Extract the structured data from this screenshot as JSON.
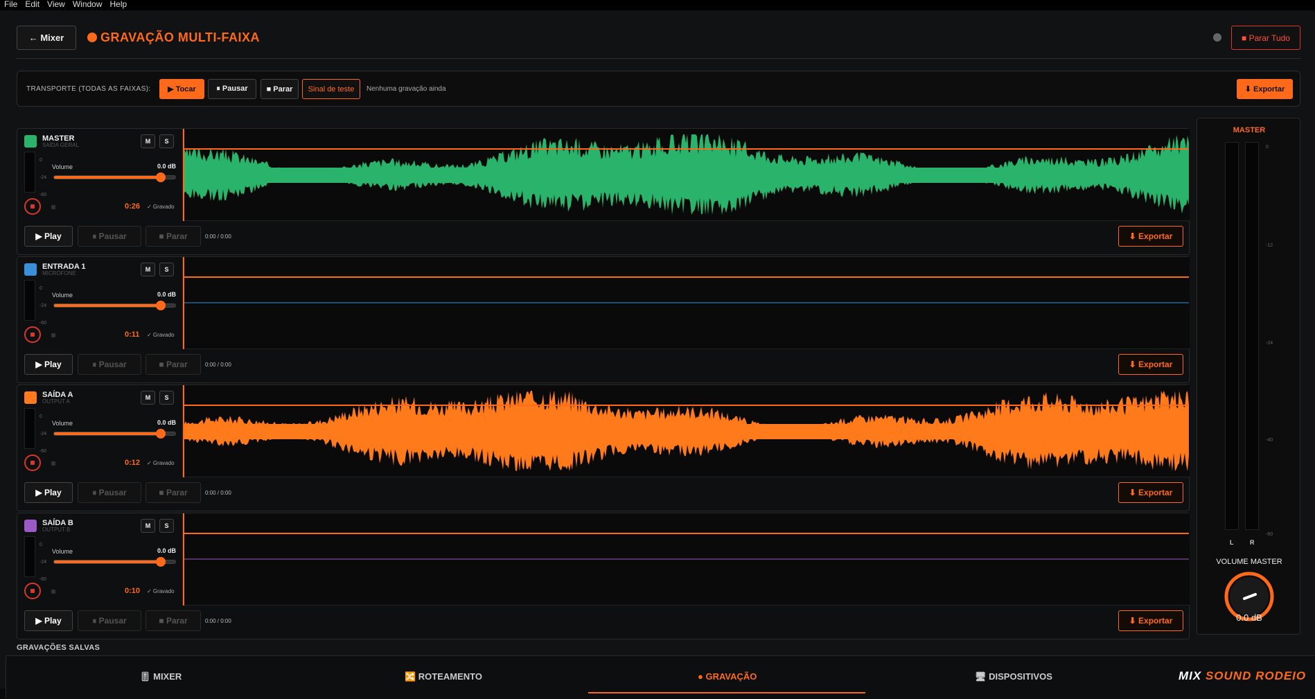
{
  "menu": [
    "File",
    "Edit",
    "View",
    "Window",
    "Help"
  ],
  "header": {
    "back_label": "← Mixer",
    "title": "GRAVAÇÃO MULTI-FAIXA",
    "stop_all": "■ Parar Tudo"
  },
  "transport": {
    "label": "TRANSPORTE (TODAS AS FAIXAS):",
    "play": "▶ Tocar",
    "pause": "⏸ Pausar",
    "stop": "■ Parar",
    "test_signal": "Sinal de teste",
    "status": "Nenhuma gravação ainda",
    "export": "⬇ Exportar"
  },
  "tracks": [
    {
      "name": "MASTER",
      "sub": "SAÍDA GERAL",
      "color": "#2ab36a",
      "volume_label": "Volume",
      "volume_db": "0.0 dB",
      "volume_level": 0.88,
      "meter_ticks": [
        "0",
        "-24",
        "-60"
      ],
      "rec_time": "0:26",
      "rec_status": "✓ Gravado",
      "mute": "M",
      "solo": "S",
      "play": "▶ Play",
      "pause": "⏸ Pausar",
      "stop": "■ Parar",
      "time": "0:00 / 0:00",
      "export": "⬇ Exportar",
      "has_wave": true
    },
    {
      "name": "ENTRADA 1",
      "sub": "MICROFONE",
      "color": "#3a8fd9",
      "volume_label": "Volume",
      "volume_db": "0.0 dB",
      "volume_level": 0.88,
      "meter_ticks": [
        "0",
        "-24",
        "-60"
      ],
      "rec_time": "0:11",
      "rec_status": "✓ Gravado",
      "mute": "M",
      "solo": "S",
      "play": "▶ Play",
      "pause": "⏸ Pausar",
      "stop": "■ Parar",
      "time": "0:00 / 0:00",
      "export": "⬇ Exportar",
      "has_wave": false
    },
    {
      "name": "SAÍDA A",
      "sub": "OUTPUT A",
      "color": "#ff7a1a",
      "volume_label": "Volume",
      "volume_db": "0.0 dB",
      "volume_level": 0.88,
      "meter_ticks": [
        "0",
        "-24",
        "-60"
      ],
      "rec_time": "0:12",
      "rec_status": "✓ Gravado",
      "mute": "M",
      "solo": "S",
      "play": "▶ Play",
      "pause": "⏸ Pausar",
      "stop": "■ Parar",
      "time": "0:00 / 0:00",
      "export": "⬇ Exportar",
      "has_wave": true
    },
    {
      "name": "SAÍDA B",
      "sub": "OUTPUT B",
      "color": "#9b59c6",
      "volume_label": "Volume",
      "volume_db": "0.0 dB",
      "volume_level": 0.88,
      "meter_ticks": [
        "0",
        "-24",
        "-60"
      ],
      "rec_time": "0:10",
      "rec_status": "✓ Gravado",
      "mute": "M",
      "solo": "S",
      "play": "▶ Play",
      "pause": "⏸ Pausar",
      "stop": "■ Parar",
      "time": "0:00 / 0:00",
      "export": "⬇ Exportar",
      "has_wave": false
    }
  ],
  "master_panel": {
    "title": "MASTER",
    "left": "L",
    "right": "R",
    "ticks": [
      "0",
      "-12",
      "-24",
      "-40",
      "-60"
    ],
    "volume_label": "VOLUME MASTER",
    "volume_value": "0.0 dB"
  },
  "saved_label": "GRAVAÇÕES SALVAS",
  "nav": [
    {
      "label": "🎚 MIXER",
      "active": false
    },
    {
      "label": "🔀 ROTEAMENTO",
      "active": false
    },
    {
      "label": "● GRAVAÇÃO",
      "active": true
    },
    {
      "label": "🖥 DISPOSITIVOS",
      "active": false
    }
  ],
  "brand": {
    "part1": "MIX ",
    "part2": "SOUND RODEIO"
  },
  "colors": {
    "accent": "#ff6a1a",
    "record": "#d9382b",
    "background": "#111214"
  }
}
